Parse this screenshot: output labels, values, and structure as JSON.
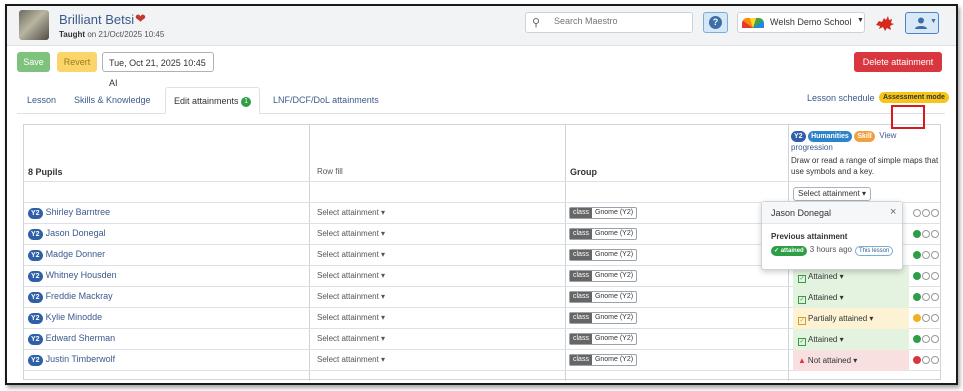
{
  "header": {
    "title": "Brilliant Betsi",
    "taught_prefix": "Taught",
    "taught_suffix": "on 21/Oct/2025 10:45",
    "search_placeholder": "Search Maestro",
    "help_label": "?",
    "school_name": "Welsh Demo School"
  },
  "toolbar": {
    "save_label": "Save",
    "revert_label": "Revert",
    "date_value": "Tue, Oct 21, 2025 10:45 AI",
    "delete_label": "Delete attainment"
  },
  "tabs": {
    "lesson": "Lesson",
    "skills": "Skills & Knowledge",
    "edit": "Edit attainments",
    "edit_count": "1",
    "lnf": "LNF/DCF/DoL attainments",
    "schedule": "Lesson schedule",
    "assessment_mode": "Assessment mode"
  },
  "table": {
    "pupils_header": "8 Pupils",
    "row_fill": "Row fill",
    "group_header": "Group",
    "objective": {
      "year": "Y2",
      "area": "Humanities",
      "type": "Skill",
      "view_progression": "View progression",
      "description": "Draw or read a range of simple maps that use symbols and a key."
    },
    "select_attainment": "Select attainment",
    "class_label": "class",
    "group_name": "Gnome (Y2)",
    "rows": [
      {
        "year": "Y2",
        "name": "Shirley Barntree",
        "attainment": "",
        "level": 0
      },
      {
        "year": "Y2",
        "name": "Jason Donegal",
        "attainment": "",
        "level": 3
      },
      {
        "year": "Y2",
        "name": "Madge Donner",
        "attainment": "",
        "level": 3
      },
      {
        "year": "Y2",
        "name": "Whitney Housden",
        "attainment": "Attained",
        "level": 3
      },
      {
        "year": "Y2",
        "name": "Freddie Mackray",
        "attainment": "Attained",
        "level": 3
      },
      {
        "year": "Y2",
        "name": "Kylie Minodde",
        "attainment": "Partially attained",
        "level": 2
      },
      {
        "year": "Y2",
        "name": "Edward Sherman",
        "attainment": "Attained",
        "level": 3
      },
      {
        "year": "Y2",
        "name": "Justin Timberwolf",
        "attainment": "Not attained",
        "level": 1
      }
    ]
  },
  "popover": {
    "name": "Jason Donegal",
    "close": "×",
    "previous": "Previous attainment",
    "badge": "attained",
    "time": "3 hours ago",
    "this_lesson": "This lesson"
  },
  "colors": {
    "attained": "#2e9e46",
    "partial": "#f0b020",
    "not_attained": "#d9373f",
    "highlight": "#d9171d"
  }
}
